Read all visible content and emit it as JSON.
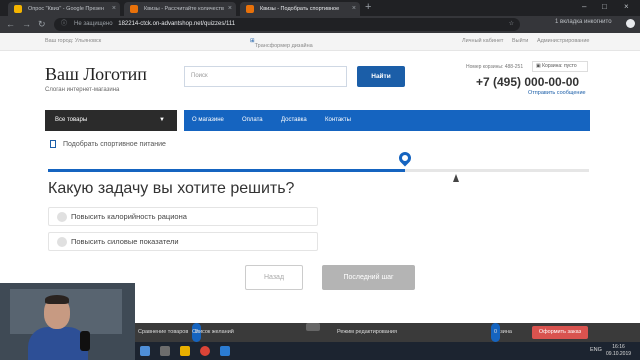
{
  "browser": {
    "tabs": [
      {
        "title": "Опрос \"Квиз\" - Google Презен",
        "color": "#f4b400"
      },
      {
        "title": "Квизы - Рассчитайте количеств",
        "color": "#e8710a"
      },
      {
        "title": "Квизы - Подобрать спортивное",
        "color": "#e8710a"
      }
    ],
    "tab_close": "×",
    "new_tab": "+",
    "win_controls": [
      "–",
      "□",
      "×"
    ],
    "nav_icons": {
      "back": "←",
      "forward": "→",
      "reload": "↻"
    },
    "not_secure": "Не защищено",
    "url": "182214-ctck.on-advantshop.net/quizzes/111",
    "incognito": "1 вкладка инкогнито"
  },
  "site": {
    "city": "Ваш город: Ульяновск",
    "transformer": "Трансформер дизайна",
    "top_links": [
      "Личный кабинет",
      "Выйти",
      "Администрирование"
    ],
    "logo": "Ваш Логотип",
    "slogan": "Слоган интернет-магазина",
    "search_placeholder": "Поиск",
    "search_button": "Найти",
    "cart_number": "Номер корзины: 488-251",
    "cart": "Корзина: пусто",
    "phone": "+7 (495) 000-00-00",
    "send_message": "Отправить сообщение",
    "catalog_button": "Все товары",
    "menu": [
      "О магазине",
      "Оплата",
      "Доставка",
      "Контакты"
    ]
  },
  "quiz": {
    "breadcrumb": "Подобрать спортивное питание",
    "progress": 0.66,
    "question": "Какую задачу вы хотите решить?",
    "options": [
      "Повысить калорийность рациона",
      "Повысить силовые показатели"
    ],
    "back_button": "Назад",
    "next_button": "Последний шаг"
  },
  "bottom_panel": {
    "compare": "Сравнение товаров",
    "wishlist_count": "0",
    "wishlist": "Список желаний",
    "edit_mode": "Режим редактирования",
    "cart_label": "Корзина",
    "cart_count": "0",
    "order_button": "Оформить заказ"
  },
  "taskbar": {
    "lang": "ENG",
    "time": "16:16",
    "date": "09.10.2019"
  },
  "colors": {
    "accent": "#1564c0",
    "dark": "#2b2b2b",
    "order": "#d9534f"
  }
}
